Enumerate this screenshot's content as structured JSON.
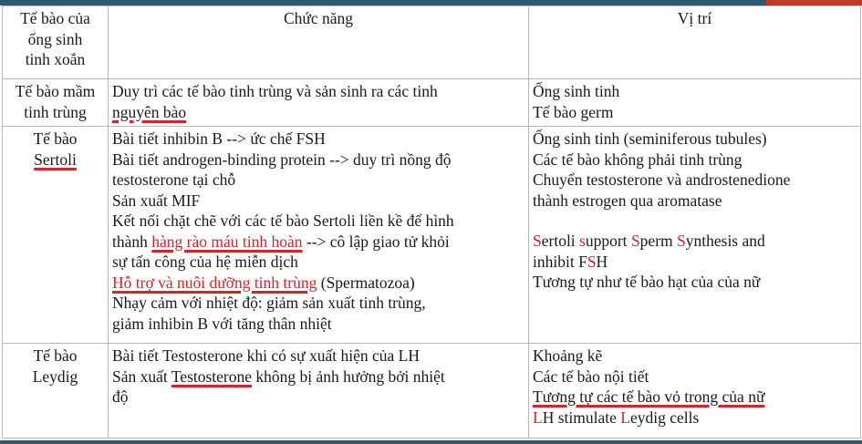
{
  "header": {
    "col1": [
      "Tế bào của",
      "ống sinh",
      "tinh xoắn"
    ],
    "col2": "Chức năng",
    "col3": "Vị trí"
  },
  "rows": [
    {
      "label": [
        "Tế bào mầm",
        "tinh trùng"
      ],
      "function": [
        "Duy trì các tế bào tinh trùng và sản sinh ra các tinh",
        "nguyên bào"
      ],
      "location": [
        "Ống sinh tinh",
        "Tế bào germ"
      ]
    },
    {
      "label": [
        "Tế bào",
        "Sertoli"
      ],
      "function": [
        "Bài tiết inhibin B --> ức chế FSH",
        "Bài tiết androgen-binding protein --> duy trì nồng độ",
        "testosterone tại chỗ",
        "Sản xuất MIF",
        "Kết nối chặt chẽ với các tế bào Sertoli liền kề để hình",
        "thành ",
        "hàng rào máu tinh hoàn",
        " --> cô lập giao tử khỏi",
        "sự tấn công của hệ miễn dịch",
        "Hỗ trợ và nuôi dưỡng tinh trùng",
        " (Spermatozoa)",
        "Nhạy cảm với nhiệt độ: giảm sản xuất tinh trùng,",
        "giảm inhibin B với tăng thân nhiệt"
      ],
      "location": [
        "Ống sinh tinh (seminiferous tubules)",
        "Các tế bào không phải tinh trùng",
        "Chuyển testosterone và androstenedione",
        "thành estrogen qua aromatase",
        "S",
        "ertoli ",
        "s",
        "upport ",
        "S",
        "perm ",
        "S",
        "ynthesis and",
        "inhibit F",
        "S",
        "H",
        "Tương tự như tế bào hạt của của nữ"
      ]
    },
    {
      "label": [
        "Tế bào",
        "Leydig"
      ],
      "function": [
        "Bài tiết Testosterone khi có sự xuất hiện của LH",
        "Sản xuất ",
        "Testosterone",
        " không bị ảnh hưởng bởi nhiệt",
        "độ"
      ],
      "location": [
        "Khoảng kẽ",
        "Các tế bào nội tiết",
        "Tương tự các tế bào vỏ trong của nữ",
        "L",
        "H stimulate ",
        "L",
        "eydig cells"
      ]
    }
  ],
  "colors": {
    "accent_red": "#d8232a",
    "frame": "#2e5a6b"
  }
}
